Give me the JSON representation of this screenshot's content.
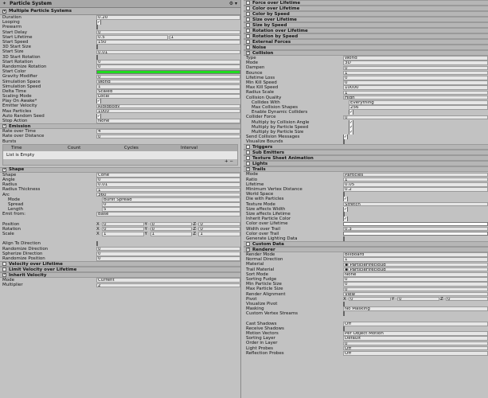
{
  "left": {
    "window_title": "Particle System",
    "header": "Multiple Particle Systems",
    "main": [
      {
        "label": "Duration",
        "value": "0.20"
      },
      {
        "label": "Looping",
        "check": true
      },
      {
        "label": "Prewarm",
        "check": false
      },
      {
        "label": "Start Delay",
        "value": "0"
      },
      {
        "label": "Start Lifetime",
        "value": "0.5",
        "value2": "1"
      },
      {
        "label": "Start Speed",
        "value": "150"
      },
      {
        "label": "3D Start Size",
        "check": false
      },
      {
        "label": "Start Size",
        "value": "0.01"
      },
      {
        "label": "3D Start Rotation",
        "check": false
      },
      {
        "label": "Start Rotation",
        "value": "0"
      },
      {
        "label": "Randomize Rotation",
        "value": "0"
      },
      {
        "label": "Start Color",
        "color": "#1fdc1f"
      },
      {
        "label": "Gravity Modifier",
        "value": "0"
      },
      {
        "label": "Simulation Space",
        "value": "World"
      },
      {
        "label": "Simulation Speed",
        "value": "1"
      },
      {
        "label": "Delta Time",
        "value": "Scaled"
      },
      {
        "label": "Scaling Mode",
        "value": "Local"
      },
      {
        "label": "Play On Awake*",
        "check": true
      },
      {
        "label": "Emitter Velocity",
        "value": "Rigidbody"
      },
      {
        "label": "Max Particles",
        "value": "1000"
      },
      {
        "label": "Auto Random Seed",
        "check": true
      },
      {
        "label": "Stop Action",
        "value": "None"
      }
    ],
    "emission": {
      "title": "Emission",
      "rows": [
        {
          "label": "Rate over Time",
          "value": "4"
        },
        {
          "label": "Rate over Distance",
          "value": "0"
        }
      ],
      "bursts_label": "Bursts",
      "bursts_cols": [
        "Time",
        "Count",
        "Cycles",
        "Interval"
      ],
      "bursts_empty": "List is Empty",
      "bursts_btns": "+   −"
    },
    "shape": {
      "title": "Shape",
      "rows": [
        {
          "label": "Shape",
          "value": "Cone"
        },
        {
          "label": "Angle",
          "value": "0"
        },
        {
          "label": "Radius",
          "value": "0.01"
        },
        {
          "label": "Radius Thickness",
          "value": "1"
        },
        {
          "label": "Arc",
          "value": "360"
        },
        {
          "label": "Mode",
          "value": "Burst Spread",
          "sub": true
        },
        {
          "label": "Spread",
          "value": "0",
          "sub": true
        },
        {
          "label": "Length",
          "value": "5",
          "sub": true
        },
        {
          "label": "Emit from:",
          "value": "Base"
        }
      ],
      "vec": [
        {
          "label": "Position",
          "x": "0",
          "y": "0",
          "z": "0"
        },
        {
          "label": "Rotation",
          "x": "0",
          "y": "0",
          "z": "0"
        },
        {
          "label": "Scale",
          "x": "1",
          "y": "1",
          "z": "1"
        }
      ],
      "rows2": [
        {
          "label": "Align To Direction",
          "check": false
        },
        {
          "label": "Randomize Direction",
          "value": "0"
        },
        {
          "label": "Spherize Direction",
          "value": "0"
        },
        {
          "label": "Randomize Position",
          "value": "0"
        }
      ]
    },
    "tail_sections": [
      {
        "title": "Velocity over Lifetime",
        "check": false
      },
      {
        "title": "Limit Velocity over Lifetime",
        "check": false
      },
      {
        "title": "Inherit Velocity",
        "check": true
      }
    ],
    "inherit": [
      {
        "label": "Mode",
        "value": "Current"
      },
      {
        "label": "Multiplier",
        "value": "2"
      }
    ]
  },
  "right": {
    "top_sections": [
      {
        "title": "Force over Lifetime",
        "check": false
      },
      {
        "title": "Color over Lifetime",
        "check": false
      },
      {
        "title": "Color by Speed",
        "check": false
      },
      {
        "title": "Size over Lifetime",
        "check": false
      },
      {
        "title": "Size by Speed",
        "check": false
      },
      {
        "title": "Rotation over Lifetime",
        "check": false
      },
      {
        "title": "Rotation by Speed",
        "check": false
      },
      {
        "title": "External Forces",
        "check": false
      },
      {
        "title": "Noise",
        "check": false
      },
      {
        "title": "Collision",
        "check": true
      }
    ],
    "collision": [
      {
        "label": "Type",
        "value": "World"
      },
      {
        "label": "Mode",
        "value": "3D"
      },
      {
        "label": "Dampen",
        "value": "0"
      },
      {
        "label": "Bounce",
        "value": "1"
      },
      {
        "label": "Lifetime Loss",
        "value": "0"
      },
      {
        "label": "Min Kill Speed",
        "value": "0"
      },
      {
        "label": "Max Kill Speed",
        "value": "10000"
      },
      {
        "label": "Radius Scale",
        "value": "1"
      },
      {
        "label": "Collision Quality",
        "value": "High"
      },
      {
        "label": "Collides With",
        "value": "Everything",
        "sub": 1
      },
      {
        "label": "Max Collision Shapes",
        "value": "256",
        "sub": 1
      },
      {
        "label": "Enable Dynamic Colliders",
        "check": true,
        "sub": 1
      },
      {
        "label": "Collider Force",
        "value": "0"
      },
      {
        "label": "Multiply by Collision Angle",
        "check": true,
        "sub": 1
      },
      {
        "label": "Multiply by Particle Speed",
        "check": true,
        "sub": 1
      },
      {
        "label": "Multiply by Particle Size",
        "check": true,
        "sub": 1
      },
      {
        "label": "Send Collision Messages",
        "check": true
      },
      {
        "label": "Visualize Bounds",
        "check": false
      }
    ],
    "mid_sections": [
      {
        "title": "Triggers",
        "check": false
      },
      {
        "title": "Sub Emitters",
        "check": false
      },
      {
        "title": "Texture Sheet Animation",
        "check": false
      },
      {
        "title": "Lights",
        "check": false
      },
      {
        "title": "Trails",
        "check": true
      }
    ],
    "trails": [
      {
        "label": "Mode",
        "value": "Particles"
      },
      {
        "label": "Ratio",
        "value": "1"
      },
      {
        "label": "Lifetime",
        "value": "0.05"
      },
      {
        "label": "Minimum Vertex Distance",
        "value": "0.2"
      },
      {
        "label": "World Space",
        "check": false
      },
      {
        "label": "Die with Particles",
        "check": true
      },
      {
        "label": "Texture Mode",
        "value": "Stretch"
      },
      {
        "label": "Size affects Width",
        "check": true
      },
      {
        "label": "Size affects Lifetime",
        "check": false
      },
      {
        "label": "Inherit Particle Color",
        "check": true
      },
      {
        "label": "Color over Lifetime",
        "color": "#ffffff"
      },
      {
        "label": "Width over Trail",
        "value": "0.3"
      },
      {
        "label": "Color over Trail",
        "color": "#ffffff"
      },
      {
        "label": "Generate Lighting Data",
        "check": false
      }
    ],
    "custom_data": {
      "title": "Custom Data",
      "check": false
    },
    "renderer_title": {
      "title": "Renderer",
      "check": true
    },
    "renderer": [
      {
        "label": "Render Mode",
        "value": "Billboard"
      },
      {
        "label": "Normal Direction",
        "value": "1"
      },
      {
        "label": "Material",
        "value": "ParticleFirecloud",
        "obj": true
      },
      {
        "label": "Trail Material",
        "value": "ParticleFirecloud",
        "obj": true
      },
      {
        "label": "Sort Mode",
        "value": "None"
      },
      {
        "label": "Sorting Fudge",
        "value": "0"
      },
      {
        "label": "Min Particle Size",
        "value": "0"
      },
      {
        "label": "Max Particle Size",
        "value": "0"
      },
      {
        "label": "Render Alignment",
        "value": "View"
      }
    ],
    "pivot": {
      "label": "Pivot",
      "x": "0",
      "y": "0",
      "z": "0"
    },
    "renderer2": [
      {
        "label": "Visualize Pivot",
        "check": false
      },
      {
        "label": "Masking",
        "value": "No Masking"
      },
      {
        "label": "Custom Vertex Streams",
        "check": false
      },
      {
        "label": "",
        "value": "",
        "blank": true
      },
      {
        "label": "Cast Shadows",
        "value": "Off"
      },
      {
        "label": "Receive Shadows",
        "check": false
      },
      {
        "label": "Motion Vectors",
        "value": "Per Object Motion"
      },
      {
        "label": "Sorting Layer",
        "value": "Default"
      },
      {
        "label": "Order in Layer",
        "value": "0"
      },
      {
        "label": "Light Probes",
        "value": "Off"
      },
      {
        "label": "Reflection Probes",
        "value": "Off"
      }
    ]
  }
}
